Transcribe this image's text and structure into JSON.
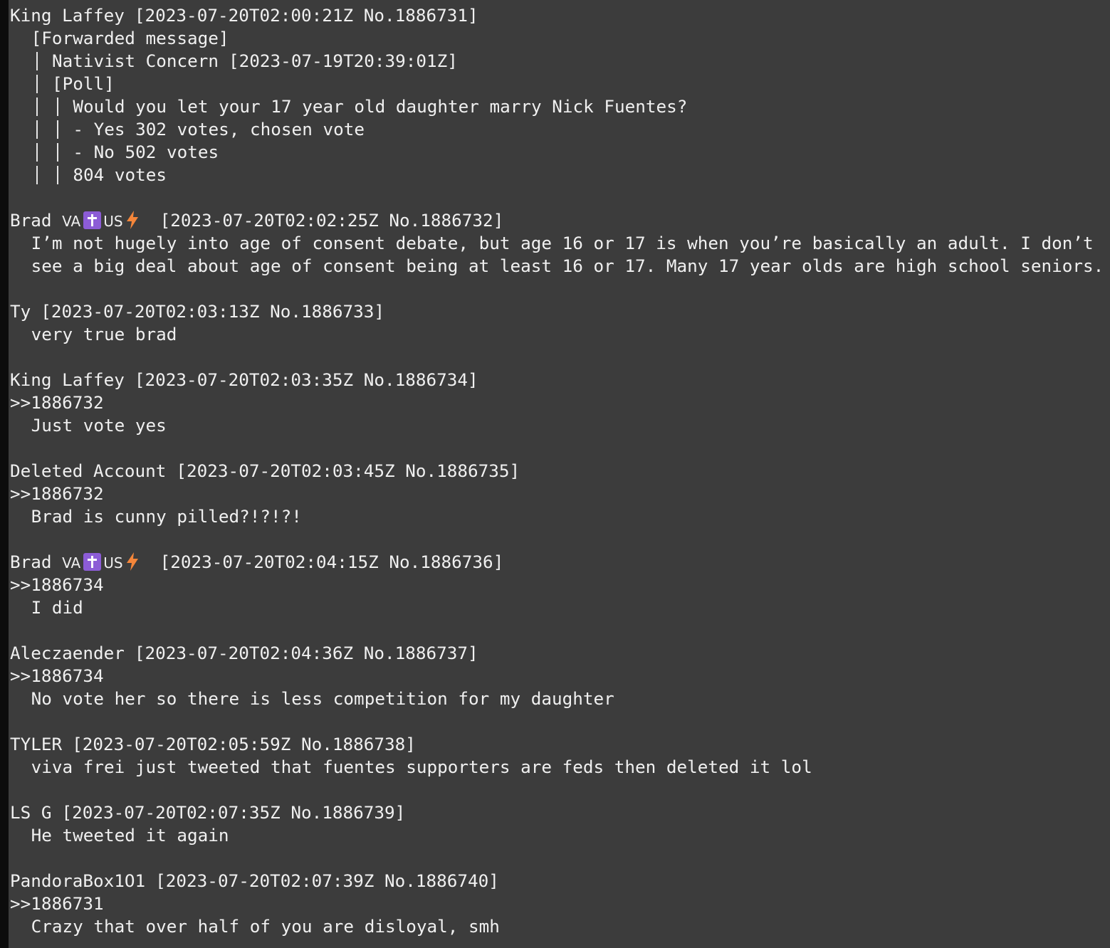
{
  "messages": [
    {
      "author": "King Laffey",
      "meta": "[2023-07-20T02:00:21Z No.1886731]",
      "forward": {
        "label": "[Forwarded message]",
        "author": "Nativist Concern",
        "meta": "[2023-07-19T20:39:01Z]",
        "poll_label": "[Poll]",
        "question": "Would you let your 17 year old daughter marry Nick Fuentes?",
        "options": [
          "- Yes 302 votes, chosen vote",
          "- No 502 votes"
        ],
        "total": "804 votes"
      }
    },
    {
      "author": "Brad",
      "author_flag": {
        "left": "VA",
        "right": "US",
        "icons": [
          "latin-cross-icon",
          "lightning-bolt-icon"
        ],
        "colors": {
          "cross_box": "#8c5cd6",
          "bolt": "#f5863a"
        }
      },
      "meta": "[2023-07-20T02:02:25Z No.1886732]",
      "body": [
        "I’m not hugely into age of consent debate, but age 16 or 17 is when you’re basically an adult. I don’t",
        "see a big deal about age of consent being at least 16 or 17. Many 17 year olds are high school seniors."
      ]
    },
    {
      "author": "Ty",
      "meta": "[2023-07-20T02:03:13Z No.1886733]",
      "body": [
        "very true brad"
      ]
    },
    {
      "author": "King Laffey",
      "meta": "[2023-07-20T02:03:35Z No.1886734]",
      "reply": ">>1886732",
      "body": [
        "Just vote yes"
      ]
    },
    {
      "author": "Deleted Account",
      "meta": "[2023-07-20T02:03:45Z No.1886735]",
      "reply": ">>1886732",
      "body": [
        "Brad is cunny pilled?!?!?!"
      ]
    },
    {
      "author": "Brad",
      "author_flag": {
        "left": "VA",
        "right": "US",
        "icons": [
          "latin-cross-icon",
          "lightning-bolt-icon"
        ],
        "colors": {
          "cross_box": "#8c5cd6",
          "bolt": "#f5863a"
        }
      },
      "meta": "[2023-07-20T02:04:15Z No.1886736]",
      "reply": ">>1886734",
      "body": [
        "I did"
      ]
    },
    {
      "author": "Aleczaender",
      "meta": "[2023-07-20T02:04:36Z No.1886737]",
      "reply": ">>1886734",
      "body": [
        "No vote her so there is less competition for my daughter"
      ]
    },
    {
      "author": "TYLER",
      "meta": "[2023-07-20T02:05:59Z No.1886738]",
      "body": [
        "viva frei just tweeted that fuentes supporters are feds then deleted it lol"
      ]
    },
    {
      "author": "LS G",
      "meta": "[2023-07-20T02:07:35Z No.1886739]",
      "body": [
        "He tweeted it again"
      ]
    },
    {
      "author": "PandoraBox1O1",
      "meta": "[2023-07-20T02:07:39Z No.1886740]",
      "reply": ">>1886731",
      "body": [
        "Crazy that over half of you are disloyal, smh"
      ]
    }
  ],
  "theme": {
    "background": "#3c3c3c",
    "foreground": "#f0f0f0",
    "left_edge": "#0c0c0c"
  }
}
